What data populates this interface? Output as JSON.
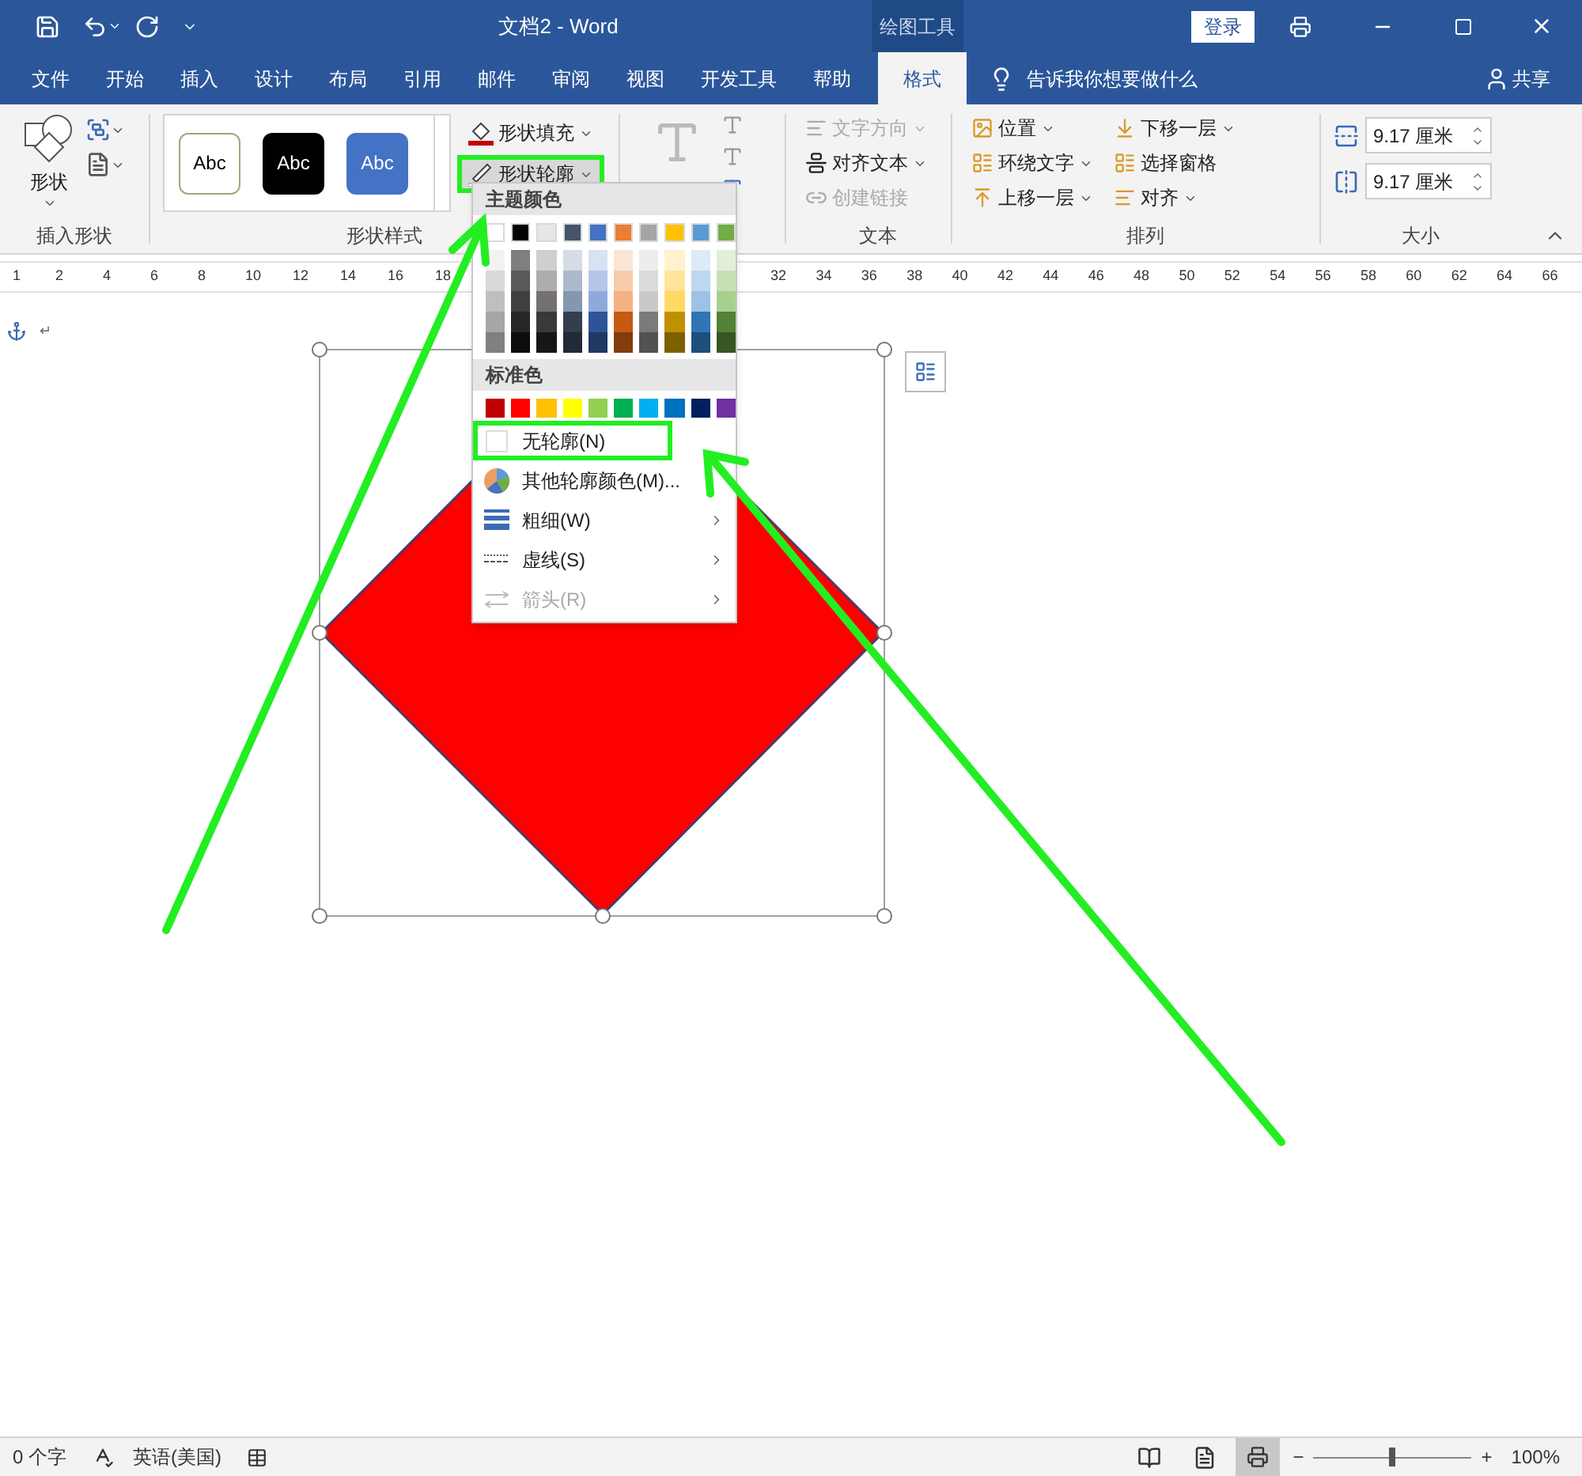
{
  "title_bar": {
    "title": "文档2 - Word",
    "context_tab": "绘图工具",
    "login": "登录"
  },
  "menu_tabs": [
    {
      "label": "文件",
      "selected": false
    },
    {
      "label": "开始",
      "selected": false
    },
    {
      "label": "插入",
      "selected": false
    },
    {
      "label": "设计",
      "selected": false
    },
    {
      "label": "布局",
      "selected": false
    },
    {
      "label": "引用",
      "selected": false
    },
    {
      "label": "邮件",
      "selected": false
    },
    {
      "label": "审阅",
      "selected": false
    },
    {
      "label": "视图",
      "selected": false
    },
    {
      "label": "开发工具",
      "selected": false
    },
    {
      "label": "帮助",
      "selected": false
    },
    {
      "label": "格式",
      "selected": true
    }
  ],
  "tell_me": "告诉我你想要做什么",
  "share": "共享",
  "ribbon": {
    "insert_shapes": {
      "shapes_button": "形状",
      "label": "插入形状"
    },
    "shape_styles": {
      "presets": [
        {
          "kind": "outline",
          "label": "Abc"
        },
        {
          "kind": "dark",
          "label": "Abc"
        },
        {
          "kind": "accent",
          "label": "Abc"
        }
      ],
      "commands": [
        {
          "label": "形状填充",
          "highlighted": false
        },
        {
          "label": "形状轮廓",
          "highlighted": true
        }
      ],
      "label": "形状样式"
    },
    "text": {
      "commands": [
        {
          "label": "文字方向",
          "disabled": true
        },
        {
          "label": "对齐文本",
          "disabled": false
        },
        {
          "label": "创建链接",
          "disabled": true
        }
      ],
      "label": "文本"
    },
    "arrange": {
      "commands": [
        {
          "label": "位置"
        },
        {
          "label": "环绕文字"
        },
        {
          "label": "上移一层"
        },
        {
          "label": "下移一层"
        },
        {
          "label": "选择窗格"
        },
        {
          "label": "对齐"
        }
      ],
      "label": "排列"
    },
    "size": {
      "height": "9.17 厘米",
      "width": "9.17 厘米",
      "label": "大小"
    }
  },
  "ruler": {
    "left_labels": [
      "1",
      "2",
      "4",
      "6",
      "8",
      "10",
      "12",
      "14",
      "16",
      "18"
    ],
    "right_labels": [
      "32",
      "34",
      "36",
      "38",
      "40",
      "42",
      "44",
      "46",
      "48",
      "50",
      "52",
      "54",
      "56",
      "58",
      "60",
      "62",
      "64",
      "66"
    ]
  },
  "document": {
    "paragraph_mark": "↵"
  },
  "outline_menu": {
    "theme_header": "主题颜色",
    "theme_colors": [
      {
        "color": "#ffffff",
        "shades": [
          {
            "color": "#f2f2f2"
          },
          {
            "color": "#d9d9d9"
          },
          {
            "color": "#bfbfbf"
          },
          {
            "color": "#a6a6a6"
          },
          {
            "color": "#808080"
          }
        ]
      },
      {
        "color": "#000000",
        "shades": [
          {
            "color": "#7f7f7f"
          },
          {
            "color": "#595959"
          },
          {
            "color": "#404040"
          },
          {
            "color": "#262626"
          },
          {
            "color": "#0d0d0d"
          }
        ]
      },
      {
        "color": "#e7e6e6",
        "shades": [
          {
            "color": "#d0cece"
          },
          {
            "color": "#aeabab"
          },
          {
            "color": "#757171"
          },
          {
            "color": "#3a3838"
          },
          {
            "color": "#171616"
          }
        ]
      },
      {
        "color": "#44546a",
        "shades": [
          {
            "color": "#d6dce4"
          },
          {
            "color": "#adb9ca"
          },
          {
            "color": "#8496b0"
          },
          {
            "color": "#333f4f"
          },
          {
            "color": "#222a35"
          }
        ]
      },
      {
        "color": "#4472c4",
        "shades": [
          {
            "color": "#d9e2f3"
          },
          {
            "color": "#b4c6e7"
          },
          {
            "color": "#8eaadb"
          },
          {
            "color": "#2f5496"
          },
          {
            "color": "#1f3864"
          }
        ]
      },
      {
        "color": "#ed7d31",
        "shades": [
          {
            "color": "#fbe5d5"
          },
          {
            "color": "#f7cbac"
          },
          {
            "color": "#f4b183"
          },
          {
            "color": "#c55a11"
          },
          {
            "color": "#843c0b"
          }
        ]
      },
      {
        "color": "#a5a5a5",
        "shades": [
          {
            "color": "#ededed"
          },
          {
            "color": "#dbdbdb"
          },
          {
            "color": "#c9c9c9"
          },
          {
            "color": "#7b7b7b"
          },
          {
            "color": "#525252"
          }
        ]
      },
      {
        "color": "#ffc000",
        "shades": [
          {
            "color": "#fff2cc"
          },
          {
            "color": "#ffe599"
          },
          {
            "color": "#ffd966"
          },
          {
            "color": "#bf9000"
          },
          {
            "color": "#7f6000"
          }
        ]
      },
      {
        "color": "#5b9bd5",
        "shades": [
          {
            "color": "#deeaf6"
          },
          {
            "color": "#bdd7ee"
          },
          {
            "color": "#9cc3e5"
          },
          {
            "color": "#2e75b5"
          },
          {
            "color": "#1e4e79"
          }
        ]
      },
      {
        "color": "#70ad47",
        "shades": [
          {
            "color": "#e2efd9"
          },
          {
            "color": "#c5e0b3"
          },
          {
            "color": "#a8d08d"
          },
          {
            "color": "#538135"
          },
          {
            "color": "#375623"
          }
        ]
      }
    ],
    "standard_header": "标准色",
    "standard_colors": [
      {
        "color": "#c00000"
      },
      {
        "color": "#ff0000"
      },
      {
        "color": "#ffc000"
      },
      {
        "color": "#ffff00"
      },
      {
        "color": "#92d050"
      },
      {
        "color": "#00b050"
      },
      {
        "color": "#00b0f0"
      },
      {
        "color": "#0070c0"
      },
      {
        "color": "#002060"
      },
      {
        "color": "#7030a0"
      }
    ],
    "items": [
      {
        "kind": "none",
        "label": "无轮廓(N)",
        "highlighted": true,
        "disabled": false,
        "submenu": false
      },
      {
        "kind": "more",
        "label": "其他轮廓颜色(M)...",
        "highlighted": false,
        "disabled": false,
        "submenu": false
      },
      {
        "kind": "weight",
        "label": "粗细(W)",
        "highlighted": false,
        "disabled": false,
        "submenu": true
      },
      {
        "kind": "dashes",
        "label": "虚线(S)",
        "highlighted": false,
        "disabled": false,
        "submenu": true
      },
      {
        "kind": "arrows",
        "label": "箭头(R)",
        "highlighted": false,
        "disabled": true,
        "submenu": true
      }
    ]
  },
  "status_bar": {
    "word_count": "0 个字",
    "language": "英语(美国)",
    "zoom_minus": "−",
    "zoom_plus": "+",
    "zoom": {
      "level": 0.5
    },
    "zoom_percent": "100%"
  }
}
